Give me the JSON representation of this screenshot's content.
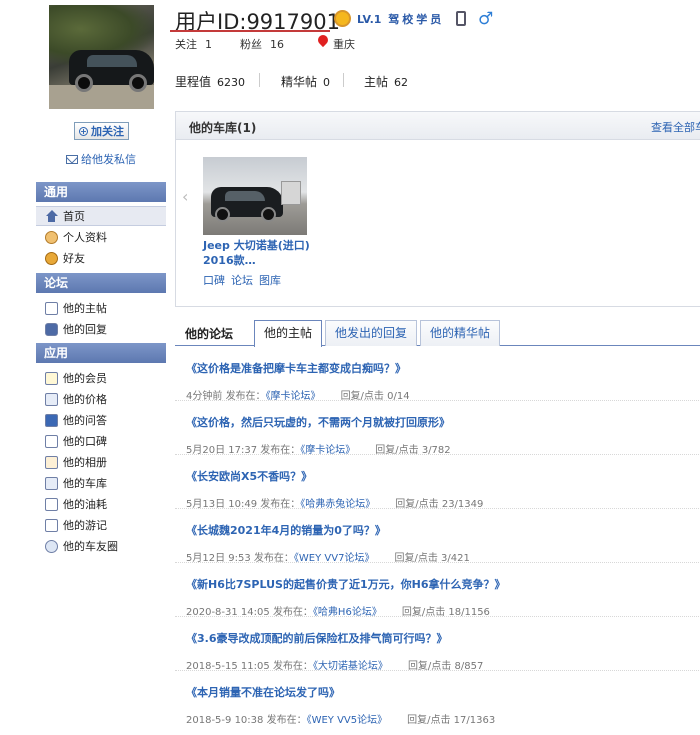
{
  "sidebar": {
    "follow_label": "加关注",
    "message_label": "给他发私信",
    "sections": [
      {
        "title": "通用"
      },
      {
        "title": "论坛"
      },
      {
        "title": "应用"
      }
    ],
    "general": [
      {
        "label": "首页",
        "icon": "home-icon"
      },
      {
        "label": "个人资料",
        "icon": "profile-icon"
      },
      {
        "label": "好友",
        "icon": "friends-icon"
      }
    ],
    "forum": [
      {
        "label": "他的主帖",
        "icon": "document-icon"
      },
      {
        "label": "他的回复",
        "icon": "chat-icon"
      }
    ],
    "apps": [
      {
        "label": "他的会员",
        "icon": "star-icon"
      },
      {
        "label": "他的价格",
        "icon": "price-icon"
      },
      {
        "label": "他的问答",
        "icon": "question-icon"
      },
      {
        "label": "他的口碑",
        "icon": "review-icon"
      },
      {
        "label": "他的相册",
        "icon": "album-icon"
      },
      {
        "label": "他的车库",
        "icon": "garage-icon"
      },
      {
        "label": "他的油耗",
        "icon": "fuel-icon"
      },
      {
        "label": "他的游记",
        "icon": "travel-icon"
      },
      {
        "label": "他的车友圈",
        "icon": "circle-icon"
      }
    ]
  },
  "profile": {
    "title": "用户ID:9917901",
    "level": "LV.1",
    "level_name": "驾校学员",
    "follow_label": "关注",
    "follow_count": "1",
    "fans_label": "粉丝",
    "fans_count": "16",
    "location": "重庆",
    "mileage_label": "里程值",
    "mileage": "6230",
    "elite_label": "精华帖",
    "elite": "0",
    "main_label": "主帖",
    "main": "62"
  },
  "garage": {
    "title": "他的车库(1)",
    "view_all": "查看全部车",
    "car_name": "Jeep 大切诺基(进口) 2016款…",
    "links": [
      "口碑",
      "论坛",
      "图库"
    ]
  },
  "forum": {
    "title": "他的论坛",
    "tabs": [
      "他的主帖",
      "他发出的回复",
      "他的精华帖"
    ],
    "posts": [
      {
        "title": "《这价格是准备把摩卡车主都变成白痴吗？》",
        "time": "4分钟前",
        "prefix": "发布在：",
        "forum": "《摩卡论坛》",
        "stats": "回复/点击 0/14"
      },
      {
        "title": "《这价格，然后只玩虚的，不需两个月就被打回原形》",
        "time": "5月20日 17:37",
        "prefix": "发布在：",
        "forum": "《摩卡论坛》",
        "stats": "回复/点击 3/782"
      },
      {
        "title": "《长安欧尚X5不香吗？》",
        "time": "5月13日 10:49",
        "prefix": "发布在：",
        "forum": "《哈弗赤兔论坛》",
        "stats": "回复/点击 23/1349"
      },
      {
        "title": "《长城魏2021年4月的销量为0了吗？》",
        "time": "5月12日 9:53",
        "prefix": "发布在：",
        "forum": "《WEY VV7论坛》",
        "stats": "回复/点击 3/421"
      },
      {
        "title": "《新H6比7SPLUS的起售价贵了近1万元，你H6拿什么竞争？》",
        "time": "2020-8-31 14:05",
        "prefix": "发布在：",
        "forum": "《哈弗H6论坛》",
        "stats": "回复/点击 18/1156"
      },
      {
        "title": "《3.6豪导改成顶配的前后保险杠及排气筒可行吗？》",
        "time": "2018-5-15 11:05",
        "prefix": "发布在：",
        "forum": "《大切诺基论坛》",
        "stats": "回复/点击 8/857"
      },
      {
        "title": "《本月销量不准在论坛发了吗》",
        "time": "2018-5-9 10:38",
        "prefix": "发布在：",
        "forum": "《WEY VV5论坛》",
        "stats": "回复/点击 17/1363"
      }
    ]
  }
}
